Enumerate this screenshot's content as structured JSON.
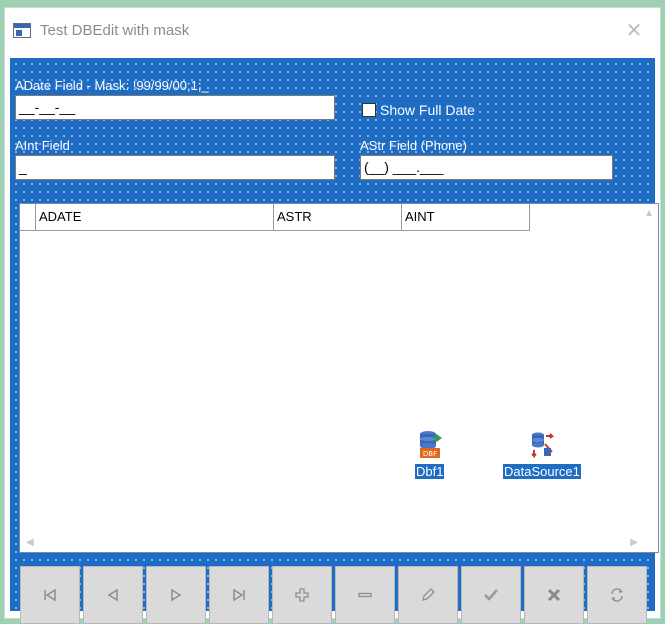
{
  "window": {
    "title": "Test DBEdit with mask",
    "close_symbol": "✕"
  },
  "fields": {
    "adate": {
      "label": "ADate Field - Mask: !99/99/00;1;_",
      "value": "__-__-__"
    },
    "show_full_date_label": "Show Full Date",
    "aint": {
      "label": "AInt Field",
      "value": "_"
    },
    "astr": {
      "label": "AStr Field (Phone)",
      "value": "(__) ___.___"
    }
  },
  "grid": {
    "columns": [
      "ADATE",
      "ASTR",
      "AINT"
    ]
  },
  "components": [
    {
      "name": "Dbf1",
      "icon": "dbf-database-icon"
    },
    {
      "name": "DataSource1",
      "icon": "datasource-icon"
    }
  ],
  "navigator": {
    "buttons": [
      {
        "name": "first",
        "icon": "first-record-icon"
      },
      {
        "name": "prior",
        "icon": "prior-record-icon"
      },
      {
        "name": "next",
        "icon": "next-record-icon"
      },
      {
        "name": "last",
        "icon": "last-record-icon"
      },
      {
        "name": "insert",
        "icon": "insert-icon"
      },
      {
        "name": "delete",
        "icon": "delete-icon"
      },
      {
        "name": "edit",
        "icon": "edit-icon"
      },
      {
        "name": "post",
        "icon": "post-icon"
      },
      {
        "name": "cancel",
        "icon": "cancel-icon"
      },
      {
        "name": "refresh",
        "icon": "refresh-icon"
      }
    ]
  }
}
